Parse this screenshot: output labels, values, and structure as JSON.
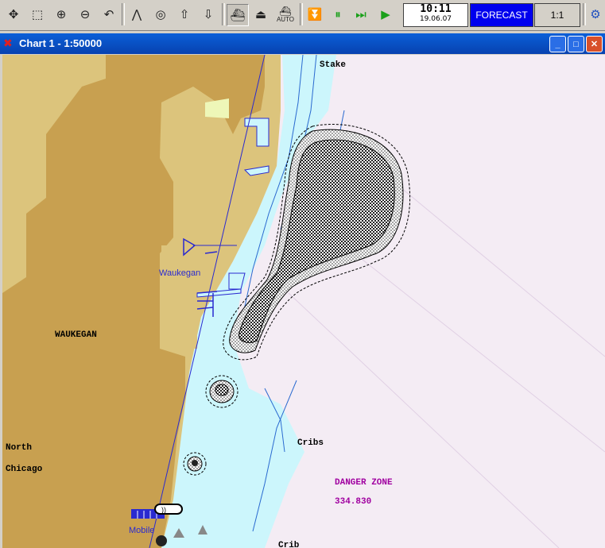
{
  "toolbar": {
    "tools": [
      {
        "name": "pan-tool-icon",
        "glyph": "✥"
      },
      {
        "name": "zoom-window-icon",
        "glyph": "⬚"
      },
      {
        "name": "zoom-in-icon",
        "glyph": "⊕"
      },
      {
        "name": "zoom-out-icon",
        "glyph": "⊖"
      },
      {
        "name": "undo-view-icon",
        "glyph": "↶"
      },
      {
        "name": "measure-icon",
        "glyph": "⋀"
      },
      {
        "name": "target-icon",
        "glyph": "◎"
      },
      {
        "name": "export-icon",
        "glyph": "⇧"
      },
      {
        "name": "import-icon",
        "glyph": "⇩"
      },
      {
        "name": "ship-view-icon",
        "glyph": "⛴"
      },
      {
        "name": "ship-outline-icon",
        "glyph": "⏏"
      },
      {
        "name": "auto-ship-icon",
        "glyph": "⛴"
      },
      {
        "name": "stop-icon",
        "glyph": "⏬"
      },
      {
        "name": "pause-icon",
        "glyph": "⏸"
      },
      {
        "name": "fast-forward-icon",
        "glyph": "⏭"
      },
      {
        "name": "play-icon",
        "glyph": "▶"
      }
    ],
    "auto_label": "AUTO",
    "time": "10:11",
    "date": "19.06.07",
    "forecast_label": "FORECAST",
    "scale_label": "1:1"
  },
  "window": {
    "title": "Chart 1 - 1:50000",
    "minimize": "_",
    "maximize": "□",
    "close": "✕"
  },
  "chart": {
    "labels": {
      "stake": "Stake",
      "waukegan_city": "WAUKEGAN",
      "waukegan_harbor": "Waukegan",
      "north": "North",
      "chicago": "Chicago",
      "cribs": "Cribs",
      "danger_zone": "DANGER ZONE",
      "danger_value": "334.830",
      "mobile": "Mobile",
      "crib": "Crib"
    },
    "colors": {
      "land": "#c8a050",
      "land_light": "#dcc47c",
      "shallow_water": "#ccf6fc",
      "deep_water": "#f4ecf4",
      "danger": "#a000a0",
      "marks": "#2a2ad0"
    }
  }
}
